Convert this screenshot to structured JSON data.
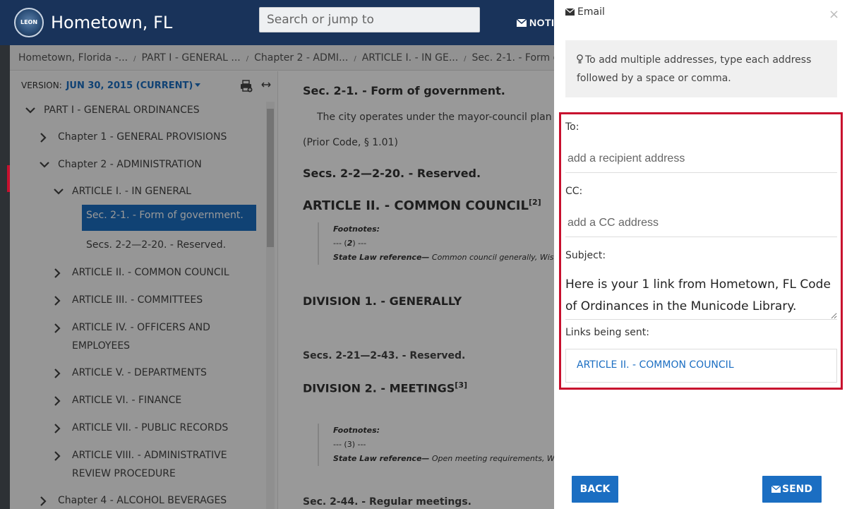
{
  "header": {
    "logo_text": "LEON",
    "brand": "Hometown, FL",
    "search_placeholder": "Search or jump to",
    "notifications_label": "NOTI"
  },
  "breadcrumb": [
    "Hometown, Florida -...",
    "PART I - GENERAL ...",
    "Chapter 2 - ADMI...",
    "ARTICLE I. - IN GE...",
    "Sec. 2-1. - Form of..."
  ],
  "toc": {
    "version_label": "VERSION:",
    "version_value": "JUN 30, 2015 (CURRENT)",
    "items": [
      {
        "label": "PART I - GENERAL ORDINANCES",
        "expanded": true
      },
      {
        "label": "Chapter 1 - GENERAL PROVISIONS",
        "expanded": false
      },
      {
        "label": "Chapter 2 - ADMINISTRATION",
        "expanded": true
      },
      {
        "label": "ARTICLE I. - IN GENERAL",
        "expanded": true
      },
      {
        "label": "Sec. 2-1. - Form of government.",
        "active": true
      },
      {
        "label": "Secs. 2-2—2-20. - Reserved."
      },
      {
        "label": "ARTICLE II. - COMMON COUNCIL",
        "expanded": false
      },
      {
        "label": "ARTICLE III. - COMMITTEES",
        "expanded": false
      },
      {
        "label_line1": "ARTICLE IV. - OFFICERS AND",
        "label_line2": "EMPLOYEES",
        "expanded": false
      },
      {
        "label": "ARTICLE V. - DEPARTMENTS",
        "expanded": false
      },
      {
        "label": "ARTICLE VI. - FINANCE",
        "expanded": false
      },
      {
        "label": "ARTICLE VII. - PUBLIC RECORDS",
        "expanded": false
      },
      {
        "label_line1": "ARTICLE VIII. - ADMINISTRATIVE",
        "label_line2": "REVIEW PROCEDURE",
        "expanded": false
      },
      {
        "label": "Chapter 4 - ALCOHOL BEVERAGES",
        "expanded": false
      }
    ]
  },
  "content": {
    "sec_2_1_title": "Sec. 2-1. - Form of government.",
    "sec_2_1_text": "The city operates under the mayor-council plan of g",
    "prior_code": "(Prior Code, § 1.01)",
    "secs_2_2_title": "Secs. 2-2—2-20. - Reserved.",
    "article_ii_title": "ARTICLE II. - COMMON COUNCIL",
    "article_ii_sup": "[2]",
    "fn1_head": "Footnotes:",
    "fn1_num_pre": "--- (",
    "fn1_num": "2",
    "fn1_num_post": ") ---",
    "fn1_ref_label": "State Law reference—",
    "fn1_ref_text": " Common council generally, Wis. Sta",
    "division1_title": "DIVISION 1. - GENERALLY",
    "secs_2_21_title": "Secs. 2-21—2-43. - Reserved.",
    "division2_title": "DIVISION 2. - MEETINGS",
    "division2_sup": "[3]",
    "fn2_head": "Footnotes:",
    "fn2_num": "--- (3) ---",
    "fn2_ref_label": "State Law reference—",
    "fn2_ref_text": " Open meeting requirements, Wis. S",
    "sec_2_44_title": "Sec. 2-44. - Regular meetings."
  },
  "email_panel": {
    "title": "Email",
    "close_glyph": "×",
    "tip": "To add multiple addresses, type each address followed by a space or comma.",
    "to_label": "To:",
    "to_placeholder": "add a recipient address",
    "cc_label": "CC:",
    "cc_placeholder": "add a CC address",
    "subject_label": "Subject:",
    "subject_value": "Here is your 1 link from Hometown, FL Code of Ordinances in the Municode Library.",
    "links_label": "Links being sent:",
    "links": [
      "ARTICLE II. - COMMON COUNCIL"
    ],
    "back_label": "BACK",
    "send_label": "SEND"
  },
  "colors": {
    "header_bg": "#19335a",
    "accent_blue": "#1b6ec2",
    "highlight_red": "#c8102e"
  }
}
